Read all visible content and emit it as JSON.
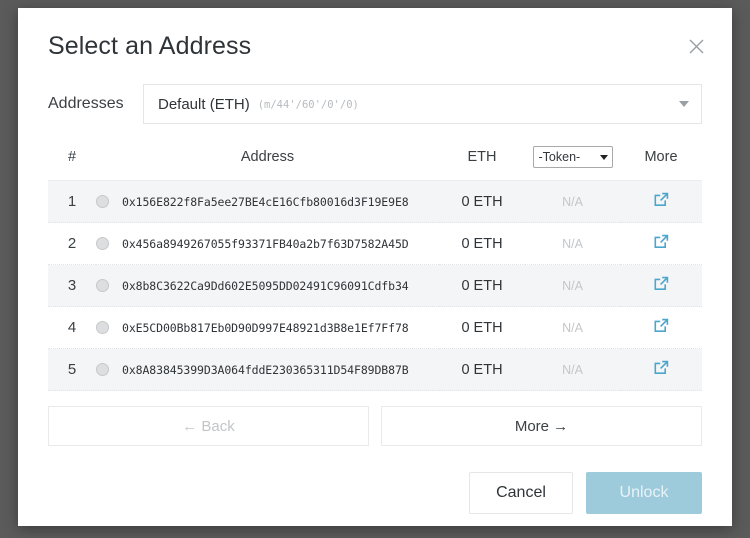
{
  "modal": {
    "title": "Select an Address",
    "close_icon": "close-icon"
  },
  "addresses_selector": {
    "label": "Addresses",
    "selected": "Default (ETH)",
    "derivation_path": "(m/44'/60'/0'/0)",
    "caret_icon": "chevron-down-icon"
  },
  "table": {
    "headers": {
      "index": "#",
      "address": "Address",
      "eth": "ETH",
      "token": "-Token-",
      "more": "More"
    },
    "token_options": [
      "-Token-"
    ],
    "rows": [
      {
        "index": "1",
        "address": "0x156E822f8Fa5ee27BE4cE16Cfb80016d3F19E9E8",
        "eth": "0 ETH",
        "token": "N/A",
        "selected": false
      },
      {
        "index": "2",
        "address": "0x456a8949267055f93371FB40a2b7f63D7582A45D",
        "eth": "0 ETH",
        "token": "N/A",
        "selected": false
      },
      {
        "index": "3",
        "address": "0x8b8C3622Ca9Dd602E5095DD02491C96091Cdfb34",
        "eth": "0 ETH",
        "token": "N/A",
        "selected": false
      },
      {
        "index": "4",
        "address": "0xE5CD00Bb817Eb0D90D997E48921d3B8e1Ef7Ff78",
        "eth": "0 ETH",
        "token": "N/A",
        "selected": false
      },
      {
        "index": "5",
        "address": "0x8A83845399D3A064fddE230365311D54F89DB87B",
        "eth": "0 ETH",
        "token": "N/A",
        "selected": false
      }
    ],
    "more_icon": "external-link-icon"
  },
  "pager": {
    "back_label": "← Back",
    "more_label": "More →"
  },
  "footer": {
    "cancel_label": "Cancel",
    "unlock_label": "Unlock"
  },
  "colors": {
    "accent_link": "#4ba6cd",
    "unlock_disabled_bg": "#9ecbdb",
    "row_shade": "#f4f5f6",
    "backdrop": "#5b5b5b"
  }
}
